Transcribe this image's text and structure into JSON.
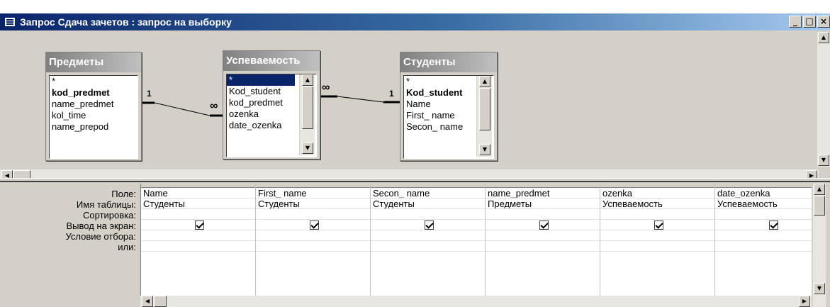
{
  "window": {
    "title": "Запрос Сдача зачетов : запрос на выборку",
    "buttons": {
      "minimize": "_",
      "maximize": "□",
      "close": "×"
    }
  },
  "tables": [
    {
      "title": "Предметы",
      "fields": [
        "*",
        "kod_predmet",
        "name_predmet",
        "kol_time",
        "name_prepod"
      ],
      "key_field": "kod_predmet"
    },
    {
      "title": "Успеваемость",
      "fields": [
        "*",
        "Kod_student",
        "kod_predmet",
        "ozenka",
        "date_ozenka"
      ],
      "selected_field": "*"
    },
    {
      "title": "Студенты",
      "fields": [
        "*",
        "Kod_student",
        "Name",
        "First_ name",
        "Secon_ name"
      ],
      "key_field": "Kod_student"
    }
  ],
  "relations": [
    {
      "left": "1",
      "right": "∞"
    },
    {
      "left": "∞",
      "right": "1"
    }
  ],
  "grid": {
    "row_labels": [
      "Поле:",
      "Имя таблицы:",
      "Сортировка:",
      "Вывод на экран:",
      "Условие отбора:",
      "или:"
    ],
    "columns": [
      {
        "field": "Name",
        "table": "Студенты",
        "show": true
      },
      {
        "field": "First_ name",
        "table": "Студенты",
        "show": true
      },
      {
        "field": "Secon_ name",
        "table": "Студенты",
        "show": true
      },
      {
        "field": "name_predmet",
        "table": "Предметы",
        "show": true
      },
      {
        "field": "ozenka",
        "table": "Успеваемость",
        "show": true
      },
      {
        "field": "date_ozenka",
        "table": "Успеваемость",
        "show": true
      }
    ]
  }
}
